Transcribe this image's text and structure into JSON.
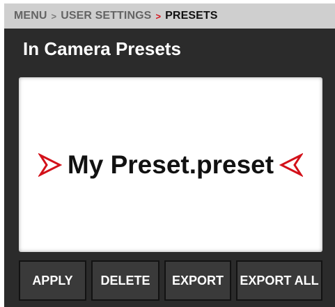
{
  "breadcrumb": {
    "items": [
      "MENU",
      "USER SETTINGS",
      "PRESETS"
    ],
    "separator": ">"
  },
  "page": {
    "title": "In Camera Presets"
  },
  "preset_list": {
    "selected_item": "My Preset.preset"
  },
  "buttons": {
    "apply": "APPLY",
    "delete": "DELETE",
    "export": "EXPORT",
    "export_all": "EXPORT ALL"
  },
  "colors": {
    "accent": "#d3111a",
    "panel_background": "#2b2b2b",
    "header_background": "#cfcfcf"
  },
  "icons": {
    "selection_left": "right-pointing-arrow-icon",
    "selection_right": "left-pointing-arrow-icon"
  }
}
